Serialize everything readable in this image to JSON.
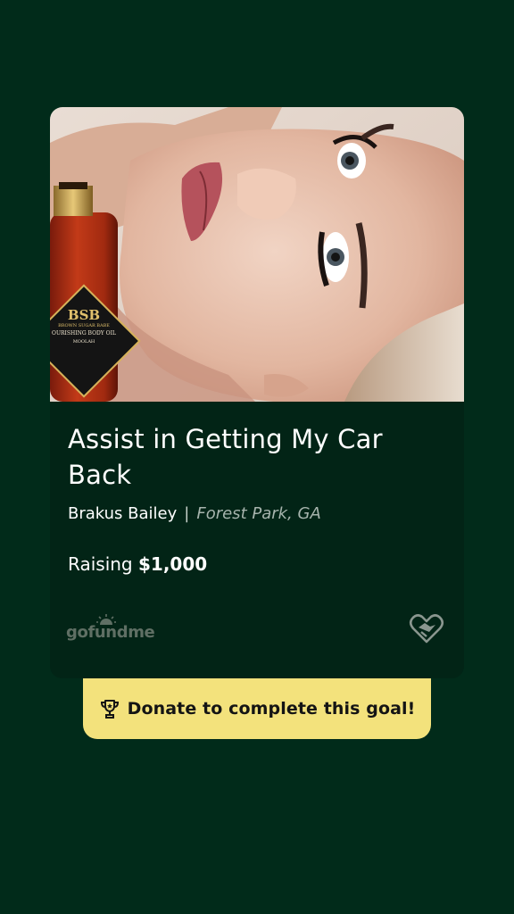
{
  "campaign": {
    "title": "Assist in Getting My Car Back",
    "organizer": "Brakus Bailey",
    "separator": "|",
    "location": "Forest Park, GA",
    "raising_label": "Raising",
    "goal": "$1,000",
    "image_description": "",
    "product_label": {
      "logo": "BSB",
      "brand": "BROWN SUGAR BABE",
      "product": "OURISHING BODY OIL",
      "scent": "MOOLAH"
    }
  },
  "brand": {
    "name": "gofundme",
    "logo_icon": "sun-icon"
  },
  "heart_icon": "handshake-heart-icon",
  "cta": {
    "label": "Donate to complete this goal!",
    "icon": "trophy-icon"
  },
  "colors": {
    "page_background": "#012b1a",
    "card_background": "#022416",
    "cta_background": "#f3e27c",
    "muted_text": "#a7b4ad"
  }
}
